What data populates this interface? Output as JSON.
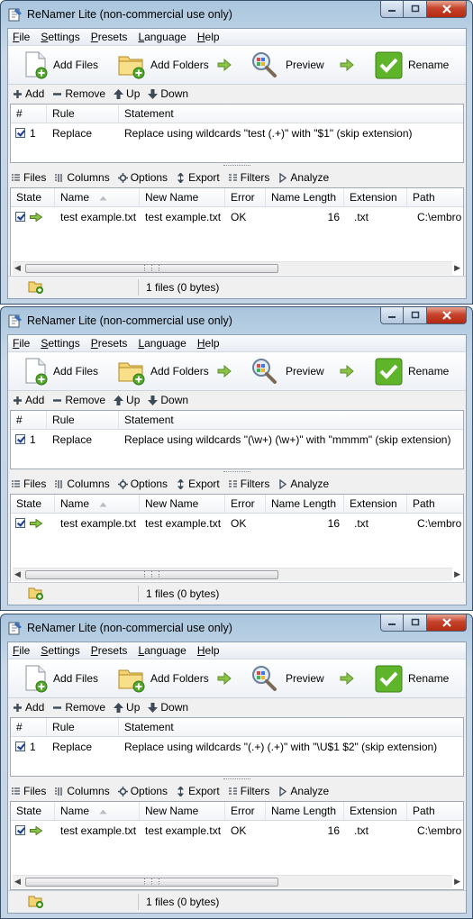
{
  "windows": [
    {
      "title": "ReNamer Lite (non-commercial use only)",
      "menu": [
        "File",
        "Settings",
        "Presets",
        "Language",
        "Help"
      ],
      "toolbar": {
        "add_files": "Add Files",
        "add_folders": "Add Folders",
        "preview": "Preview",
        "rename": "Rename"
      },
      "rule_toolbar": {
        "add": "Add",
        "remove": "Remove",
        "up": "Up",
        "down": "Down"
      },
      "rules_headers": {
        "num": "#",
        "rule": "Rule",
        "statement": "Statement"
      },
      "rule_row": {
        "num": "1",
        "rule": "Replace",
        "statement": "Replace using wildcards \"test (.+)\" with \"$1\" (skip extension)"
      },
      "file_toolbar": {
        "files": "Files",
        "columns": "Columns",
        "options": "Options",
        "export": "Export",
        "filters": "Filters",
        "analyze": "Analyze"
      },
      "files_headers": {
        "state": "State",
        "name": "Name",
        "new_name": "New Name",
        "error": "Error",
        "name_length": "Name Length",
        "extension": "Extension",
        "path": "Path"
      },
      "file_row": {
        "name": "test example.txt",
        "new_name": "test example.txt",
        "error": "OK",
        "name_length": "16",
        "extension": ".txt",
        "path": "C:\\embro"
      },
      "status": "1 files (0 bytes)"
    },
    {
      "title": "ReNamer Lite (non-commercial use only)",
      "menu": [
        "File",
        "Settings",
        "Presets",
        "Language",
        "Help"
      ],
      "toolbar": {
        "add_files": "Add Files",
        "add_folders": "Add Folders",
        "preview": "Preview",
        "rename": "Rename"
      },
      "rule_toolbar": {
        "add": "Add",
        "remove": "Remove",
        "up": "Up",
        "down": "Down"
      },
      "rules_headers": {
        "num": "#",
        "rule": "Rule",
        "statement": "Statement"
      },
      "rule_row": {
        "num": "1",
        "rule": "Replace",
        "statement": "Replace using wildcards \"(\\w+) (\\w+)\" with \"mmmm\" (skip extension)"
      },
      "file_toolbar": {
        "files": "Files",
        "columns": "Columns",
        "options": "Options",
        "export": "Export",
        "filters": "Filters",
        "analyze": "Analyze"
      },
      "files_headers": {
        "state": "State",
        "name": "Name",
        "new_name": "New Name",
        "error": "Error",
        "name_length": "Name Length",
        "extension": "Extension",
        "path": "Path"
      },
      "file_row": {
        "name": "test example.txt",
        "new_name": "test example.txt",
        "error": "OK",
        "name_length": "16",
        "extension": ".txt",
        "path": "C:\\embro"
      },
      "status": "1 files (0 bytes)"
    },
    {
      "title": "ReNamer Lite (non-commercial use only)",
      "menu": [
        "File",
        "Settings",
        "Presets",
        "Language",
        "Help"
      ],
      "toolbar": {
        "add_files": "Add Files",
        "add_folders": "Add Folders",
        "preview": "Preview",
        "rename": "Rename"
      },
      "rule_toolbar": {
        "add": "Add",
        "remove": "Remove",
        "up": "Up",
        "down": "Down"
      },
      "rules_headers": {
        "num": "#",
        "rule": "Rule",
        "statement": "Statement"
      },
      "rule_row": {
        "num": "1",
        "rule": "Replace",
        "statement": "Replace using wildcards \"(.+) (.+)\" with \"\\U$1 $2\" (skip extension)"
      },
      "file_toolbar": {
        "files": "Files",
        "columns": "Columns",
        "options": "Options",
        "export": "Export",
        "filters": "Filters",
        "analyze": "Analyze"
      },
      "files_headers": {
        "state": "State",
        "name": "Name",
        "new_name": "New Name",
        "error": "Error",
        "name_length": "Name Length",
        "extension": "Extension",
        "path": "Path"
      },
      "file_row": {
        "name": "test example.txt",
        "new_name": "test example.txt",
        "error": "OK",
        "name_length": "16",
        "extension": ".txt",
        "path": "C:\\embro"
      },
      "status": "1 files (0 bytes)"
    }
  ]
}
